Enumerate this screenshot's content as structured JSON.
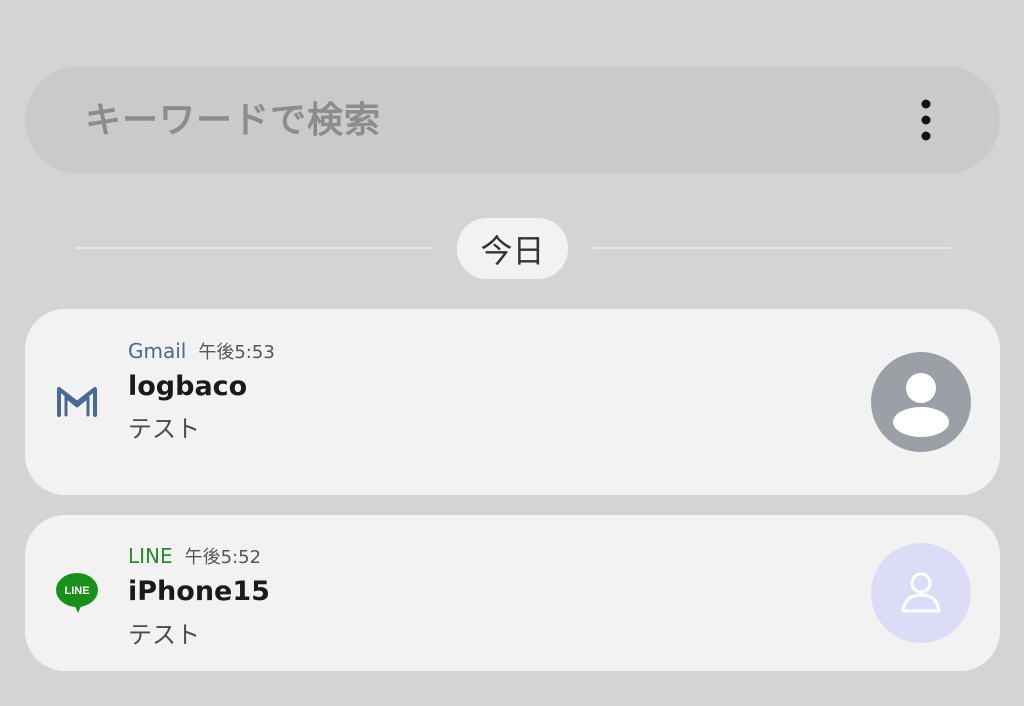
{
  "search": {
    "placeholder": "キーワードで検索",
    "more_icon": "more-vertical-icon"
  },
  "divider": {
    "date_label": "今日"
  },
  "notifications": [
    {
      "app": "Gmail",
      "app_icon": "gmail-icon",
      "app_color": "#4a6894",
      "time": "午後5:53",
      "sender": "logbaco",
      "message": "テスト",
      "avatar": "default-avatar-icon",
      "avatar_color": "#9aa0a6"
    },
    {
      "app": "LINE",
      "app_icon": "line-icon",
      "app_color": "#2b8a2b",
      "time": "午後5:52",
      "sender": "iPhone15",
      "message": "テスト",
      "avatar": "person-outline-icon",
      "avatar_color": "#dcdcf7"
    }
  ]
}
